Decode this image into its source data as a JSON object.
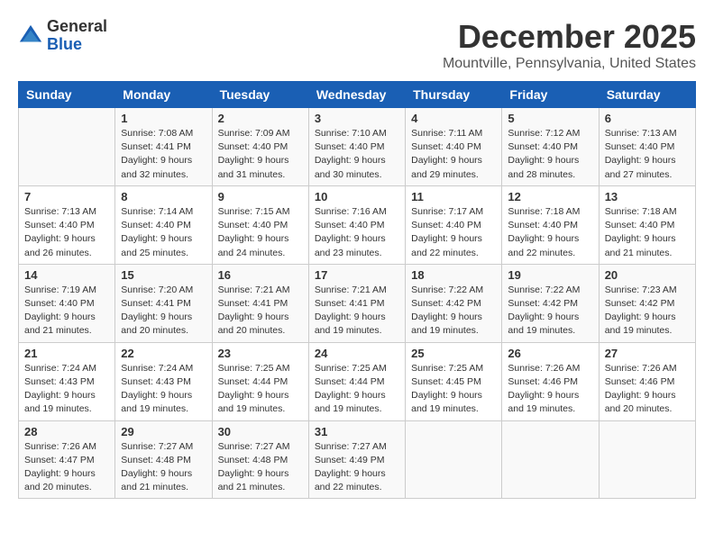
{
  "logo": {
    "general": "General",
    "blue": "Blue"
  },
  "title": "December 2025",
  "subtitle": "Mountville, Pennsylvania, United States",
  "days_of_week": [
    "Sunday",
    "Monday",
    "Tuesday",
    "Wednesday",
    "Thursday",
    "Friday",
    "Saturday"
  ],
  "weeks": [
    [
      {
        "day": "",
        "sunrise": "",
        "sunset": "",
        "daylight": ""
      },
      {
        "day": "1",
        "sunrise": "Sunrise: 7:08 AM",
        "sunset": "Sunset: 4:41 PM",
        "daylight": "Daylight: 9 hours and 32 minutes."
      },
      {
        "day": "2",
        "sunrise": "Sunrise: 7:09 AM",
        "sunset": "Sunset: 4:40 PM",
        "daylight": "Daylight: 9 hours and 31 minutes."
      },
      {
        "day": "3",
        "sunrise": "Sunrise: 7:10 AM",
        "sunset": "Sunset: 4:40 PM",
        "daylight": "Daylight: 9 hours and 30 minutes."
      },
      {
        "day": "4",
        "sunrise": "Sunrise: 7:11 AM",
        "sunset": "Sunset: 4:40 PM",
        "daylight": "Daylight: 9 hours and 29 minutes."
      },
      {
        "day": "5",
        "sunrise": "Sunrise: 7:12 AM",
        "sunset": "Sunset: 4:40 PM",
        "daylight": "Daylight: 9 hours and 28 minutes."
      },
      {
        "day": "6",
        "sunrise": "Sunrise: 7:13 AM",
        "sunset": "Sunset: 4:40 PM",
        "daylight": "Daylight: 9 hours and 27 minutes."
      }
    ],
    [
      {
        "day": "7",
        "sunrise": "Sunrise: 7:13 AM",
        "sunset": "Sunset: 4:40 PM",
        "daylight": "Daylight: 9 hours and 26 minutes."
      },
      {
        "day": "8",
        "sunrise": "Sunrise: 7:14 AM",
        "sunset": "Sunset: 4:40 PM",
        "daylight": "Daylight: 9 hours and 25 minutes."
      },
      {
        "day": "9",
        "sunrise": "Sunrise: 7:15 AM",
        "sunset": "Sunset: 4:40 PM",
        "daylight": "Daylight: 9 hours and 24 minutes."
      },
      {
        "day": "10",
        "sunrise": "Sunrise: 7:16 AM",
        "sunset": "Sunset: 4:40 PM",
        "daylight": "Daylight: 9 hours and 23 minutes."
      },
      {
        "day": "11",
        "sunrise": "Sunrise: 7:17 AM",
        "sunset": "Sunset: 4:40 PM",
        "daylight": "Daylight: 9 hours and 22 minutes."
      },
      {
        "day": "12",
        "sunrise": "Sunrise: 7:18 AM",
        "sunset": "Sunset: 4:40 PM",
        "daylight": "Daylight: 9 hours and 22 minutes."
      },
      {
        "day": "13",
        "sunrise": "Sunrise: 7:18 AM",
        "sunset": "Sunset: 4:40 PM",
        "daylight": "Daylight: 9 hours and 21 minutes."
      }
    ],
    [
      {
        "day": "14",
        "sunrise": "Sunrise: 7:19 AM",
        "sunset": "Sunset: 4:40 PM",
        "daylight": "Daylight: 9 hours and 21 minutes."
      },
      {
        "day": "15",
        "sunrise": "Sunrise: 7:20 AM",
        "sunset": "Sunset: 4:41 PM",
        "daylight": "Daylight: 9 hours and 20 minutes."
      },
      {
        "day": "16",
        "sunrise": "Sunrise: 7:21 AM",
        "sunset": "Sunset: 4:41 PM",
        "daylight": "Daylight: 9 hours and 20 minutes."
      },
      {
        "day": "17",
        "sunrise": "Sunrise: 7:21 AM",
        "sunset": "Sunset: 4:41 PM",
        "daylight": "Daylight: 9 hours and 19 minutes."
      },
      {
        "day": "18",
        "sunrise": "Sunrise: 7:22 AM",
        "sunset": "Sunset: 4:42 PM",
        "daylight": "Daylight: 9 hours and 19 minutes."
      },
      {
        "day": "19",
        "sunrise": "Sunrise: 7:22 AM",
        "sunset": "Sunset: 4:42 PM",
        "daylight": "Daylight: 9 hours and 19 minutes."
      },
      {
        "day": "20",
        "sunrise": "Sunrise: 7:23 AM",
        "sunset": "Sunset: 4:42 PM",
        "daylight": "Daylight: 9 hours and 19 minutes."
      }
    ],
    [
      {
        "day": "21",
        "sunrise": "Sunrise: 7:24 AM",
        "sunset": "Sunset: 4:43 PM",
        "daylight": "Daylight: 9 hours and 19 minutes."
      },
      {
        "day": "22",
        "sunrise": "Sunrise: 7:24 AM",
        "sunset": "Sunset: 4:43 PM",
        "daylight": "Daylight: 9 hours and 19 minutes."
      },
      {
        "day": "23",
        "sunrise": "Sunrise: 7:25 AM",
        "sunset": "Sunset: 4:44 PM",
        "daylight": "Daylight: 9 hours and 19 minutes."
      },
      {
        "day": "24",
        "sunrise": "Sunrise: 7:25 AM",
        "sunset": "Sunset: 4:44 PM",
        "daylight": "Daylight: 9 hours and 19 minutes."
      },
      {
        "day": "25",
        "sunrise": "Sunrise: 7:25 AM",
        "sunset": "Sunset: 4:45 PM",
        "daylight": "Daylight: 9 hours and 19 minutes."
      },
      {
        "day": "26",
        "sunrise": "Sunrise: 7:26 AM",
        "sunset": "Sunset: 4:46 PM",
        "daylight": "Daylight: 9 hours and 19 minutes."
      },
      {
        "day": "27",
        "sunrise": "Sunrise: 7:26 AM",
        "sunset": "Sunset: 4:46 PM",
        "daylight": "Daylight: 9 hours and 20 minutes."
      }
    ],
    [
      {
        "day": "28",
        "sunrise": "Sunrise: 7:26 AM",
        "sunset": "Sunset: 4:47 PM",
        "daylight": "Daylight: 9 hours and 20 minutes."
      },
      {
        "day": "29",
        "sunrise": "Sunrise: 7:27 AM",
        "sunset": "Sunset: 4:48 PM",
        "daylight": "Daylight: 9 hours and 21 minutes."
      },
      {
        "day": "30",
        "sunrise": "Sunrise: 7:27 AM",
        "sunset": "Sunset: 4:48 PM",
        "daylight": "Daylight: 9 hours and 21 minutes."
      },
      {
        "day": "31",
        "sunrise": "Sunrise: 7:27 AM",
        "sunset": "Sunset: 4:49 PM",
        "daylight": "Daylight: 9 hours and 22 minutes."
      },
      {
        "day": "",
        "sunrise": "",
        "sunset": "",
        "daylight": ""
      },
      {
        "day": "",
        "sunrise": "",
        "sunset": "",
        "daylight": ""
      },
      {
        "day": "",
        "sunrise": "",
        "sunset": "",
        "daylight": ""
      }
    ]
  ]
}
